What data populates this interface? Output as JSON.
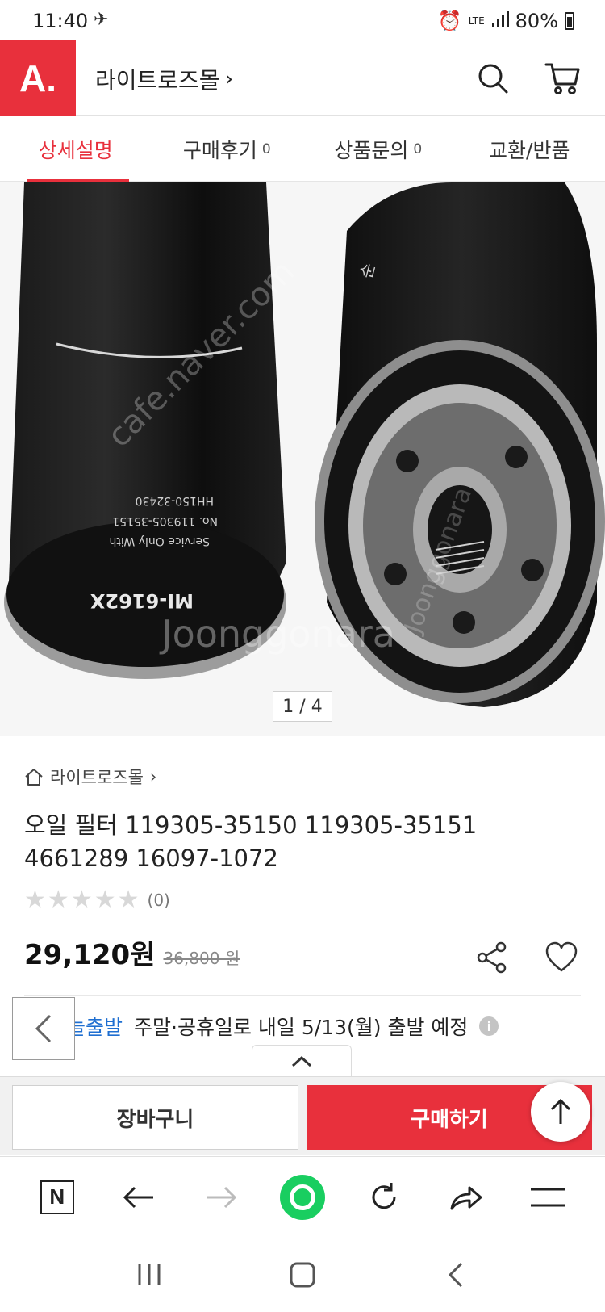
{
  "status_bar": {
    "time": "11:40",
    "network": "LTE",
    "battery": "80%"
  },
  "header": {
    "logo_text": "A.",
    "store_name": "라이트로즈몰",
    "store_chevron": "›",
    "search_icon": "search-icon",
    "cart_icon": "cart-icon"
  },
  "tabs": [
    {
      "label": "상세설명",
      "count": "",
      "active": true
    },
    {
      "label": "구매후기",
      "count": "0",
      "active": false
    },
    {
      "label": "상품문의",
      "count": "0",
      "active": false
    },
    {
      "label": "교환/반품",
      "count": "",
      "active": false
    }
  ],
  "gallery": {
    "indicator": "1 / 4",
    "watermark_1": "cafe.naver.com",
    "watermark_2": "Joonggonara",
    "label_model": "MI-6162X",
    "label_line1": "Service Only With",
    "label_line2": "No. 119305-35151",
    "label_line3": "HH150-32430"
  },
  "product": {
    "breadcrumb": "라이트로즈몰",
    "breadcrumb_chevron": "›",
    "title": "오일 필터 119305-35150 119305-35151 4661289 16097-1072",
    "rating_count": "(0)",
    "price": "29,120원",
    "original_price": "36,800 원"
  },
  "shipping": {
    "tag": "오늘출발",
    "text": "주말·공휴일로 내일 5/13(월) 출발 예정",
    "info": "i"
  },
  "actions": {
    "cart_button": "장바구니",
    "buy_button": "구매하기"
  },
  "browser_bar": {
    "naver": "N"
  },
  "colors": {
    "brand_red": "#e8303c",
    "ship_blue": "#1f6fd1",
    "naver_green": "#19ce60"
  }
}
